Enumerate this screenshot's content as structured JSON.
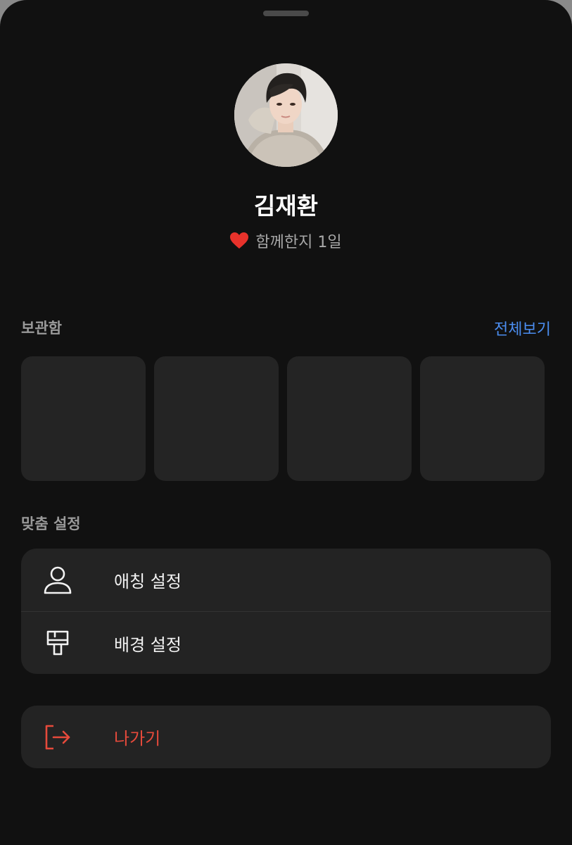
{
  "profile": {
    "name": "김재환",
    "together_text": "함께한지 1일",
    "heart_color": "#e8322b"
  },
  "storage": {
    "title": "보관함",
    "view_all_label": "전체보기",
    "slots": [
      "",
      "",
      "",
      ""
    ]
  },
  "custom_settings": {
    "title": "맞춤 설정",
    "items": [
      {
        "label": "애칭 설정",
        "icon": "person-icon"
      },
      {
        "label": "배경 설정",
        "icon": "paint-brush-icon"
      }
    ]
  },
  "exit": {
    "label": "나가기",
    "icon": "exit-icon",
    "color": "#e64a3b"
  },
  "colors": {
    "background": "#111111",
    "card": "#232323",
    "accent_link": "#4b8df0"
  }
}
